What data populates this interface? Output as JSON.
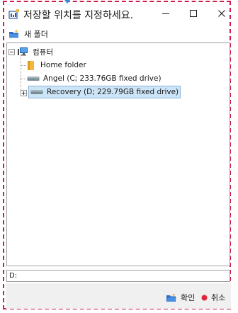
{
  "window": {
    "title": "저장할 위치를 지정하세요.",
    "minimize_glyph": "—",
    "maximize_glyph": "☐",
    "close_glyph": "✕"
  },
  "toolbar": {
    "new_folder_label": "새 폴더"
  },
  "tree": {
    "root": {
      "label": "컴퓨터",
      "icon": "computer-icon",
      "expanded": true
    },
    "items": [
      {
        "label": "Home folder",
        "icon": "folder-icon"
      },
      {
        "label": "Angel (C; 233.76GB fixed drive)",
        "icon": "drive-icon"
      },
      {
        "label": "Recovery (D; 229.79GB fixed drive)",
        "icon": "drive-icon",
        "selected": true,
        "collapsed": true
      }
    ]
  },
  "path": {
    "value": "D:"
  },
  "footer": {
    "ok_label": "확인",
    "cancel_label": "취소"
  },
  "colors": {
    "frame_border": "#cf1d4e",
    "selection": "#cce4f7",
    "footer_bg": "#f0f0f0",
    "cancel_dot": "#e0283c",
    "folder": "#f3b73b"
  }
}
